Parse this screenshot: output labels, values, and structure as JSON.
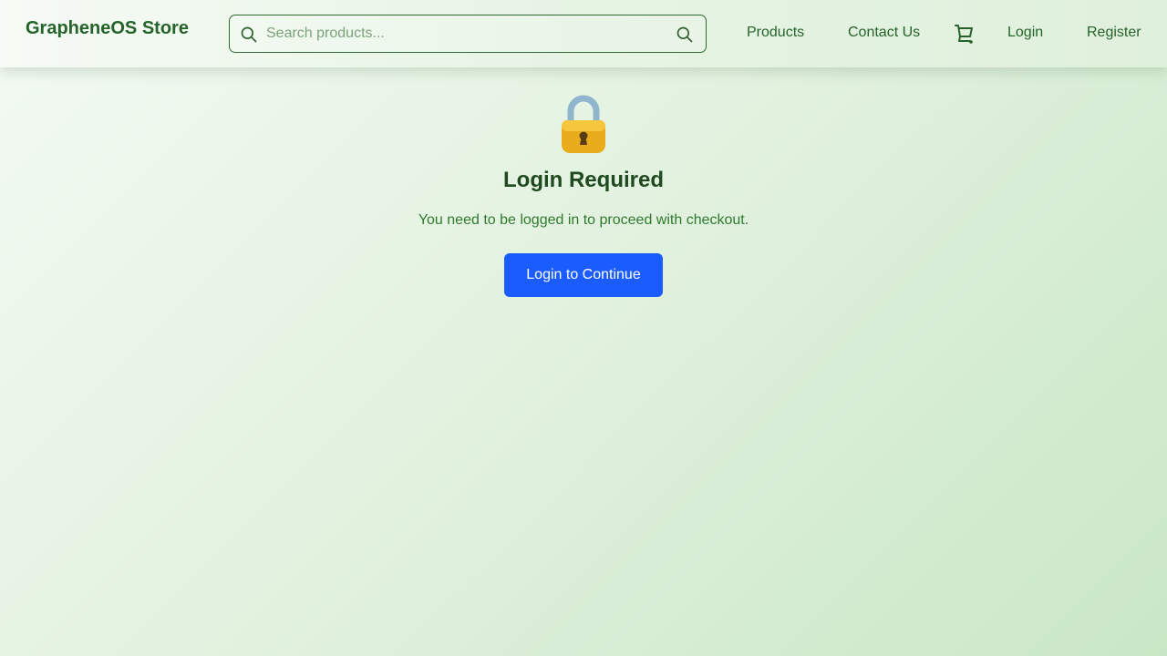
{
  "header": {
    "brand": "GrapheneOS Store",
    "search": {
      "placeholder": "Search products...",
      "value": "",
      "lead_icon": "search-icon",
      "submit_icon": "search-icon"
    },
    "nav": {
      "products": "Products",
      "contact": "Contact Us",
      "cart_icon": "shopping-cart-icon",
      "login": "Login",
      "register": "Register"
    }
  },
  "main": {
    "icon": "lock-icon",
    "title": "Login Required",
    "message": "You need to be logged in to proceed with checkout.",
    "cta_label": "Login to Continue"
  },
  "colors": {
    "brand_green": "#25632a",
    "title_green": "#1f4a1f",
    "message_green": "#2f7a2f",
    "primary_button": "#1a5cff"
  }
}
